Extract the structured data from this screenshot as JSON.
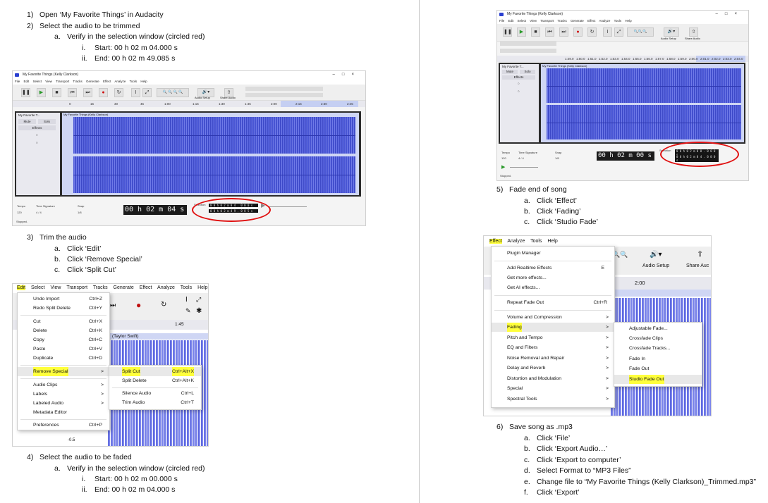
{
  "left": {
    "step1": {
      "num": "1)",
      "text": "Open ‘My Favorite Things’ in Audacity"
    },
    "step2": {
      "num": "2)",
      "text": "Select the audio to be trimmed"
    },
    "step2a": {
      "num": "a.",
      "text": "Verify in the selection window (circled red)"
    },
    "step2ai": {
      "num": "i.",
      "text": "Start: 00 h 02 m 04.000 s"
    },
    "step2aii": {
      "num": "ii.",
      "text": "End: 00 h 02 m 49.085 s"
    },
    "step3": {
      "num": "3)",
      "text": "Trim the audio"
    },
    "step3a": {
      "num": "a.",
      "text": "Click ‘Edit’"
    },
    "step3b": {
      "num": "b.",
      "text": "Click ‘Remove Special’"
    },
    "step3c": {
      "num": "c.",
      "text": "Click ‘Split Cut’"
    },
    "step4": {
      "num": "4)",
      "text": "Select the audio to be faded"
    },
    "step4a": {
      "num": "a.",
      "text": "Verify in the selection window (circled red)"
    },
    "step4ai": {
      "num": "i.",
      "text": "Start: 00 h 02 m 00.000 s"
    },
    "step4aii": {
      "num": "ii.",
      "text": "End: 00 h 02 m 04.000 s"
    }
  },
  "right": {
    "step5": {
      "num": "5)",
      "text": "Fade end of song"
    },
    "step5a": {
      "num": "a.",
      "text": "Click ‘Effect’"
    },
    "step5b": {
      "num": "b.",
      "text": "Click ‘Fading’"
    },
    "step5c": {
      "num": "c.",
      "text": "Click ‘Studio Fade’"
    },
    "step6": {
      "num": "6)",
      "text": "Save song as .mp3"
    },
    "step6a": {
      "num": "a.",
      "text": "Click ‘File’"
    },
    "step6b": {
      "num": "b.",
      "text": "Click ‘Export Audio…’"
    },
    "step6c": {
      "num": "c.",
      "text": "Click ‘Export to computer’"
    },
    "step6d": {
      "num": "d.",
      "text": "Select Format to “MP3 Files”"
    },
    "step6e": {
      "num": "e.",
      "text": "Change file to “My Favorite Things (Kelly Clarkson)_Trimmed.mp3”"
    },
    "step6f": {
      "num": "f.",
      "text": "Click ‘Export’"
    }
  },
  "shot1": {
    "title": "My Favorite Things (Kelly Clarkson)",
    "menu": "File Edit Select View Transport Tracks Generate Effect Analyze Tools Help",
    "ruler_ticks": [
      "0",
      "15",
      "30",
      "45",
      "1:00",
      "1:15",
      "1:30",
      "1:45",
      "2:00",
      "2:15",
      "2:30",
      "2:45"
    ],
    "track_name": "My Favorite T...",
    "clip_name": "My Favorite Things (Kelly Clarkson)",
    "mute": "Mute",
    "solo": "Solo",
    "effects": "Effects",
    "tempo_label": "Tempo",
    "tempo_value": "120",
    "timesig_label": "Time Signature",
    "timesig_value": "4 / 4",
    "snap_label": "Snap",
    "snap_value": "1/8",
    "audio_setup": "Audio Setup",
    "share_audio": "Share Audio",
    "time": "00 h 02 m 04 s",
    "selection_label": "Selection",
    "sel_start": "0 0 h 0 2 m 0 4 . 0 0 0 s",
    "sel_end": "0 0 h 0 2 m 4 9 . 0 8 5 s",
    "status": "Stopped."
  },
  "shot2": {
    "title": "My Favorite Things (Kelly Clarkson)",
    "menu": "File Edit Select View Transport Tracks Generate Effect Analyze Tools Help",
    "ruler_ticks": [
      "1:49.0",
      "1:50.0",
      "1:51.0",
      "1:52.0",
      "1:53.0",
      "1:54.0",
      "1:55.0",
      "1:56.0",
      "1:57.0",
      "1:58.0",
      "1:59.0",
      "2:00.0",
      "2:01.0",
      "2:02.0",
      "2:03.0",
      "2:04.0"
    ],
    "track_name": "My Favorite T...",
    "clip_name": "My Favorite Things (Kelly Clarkson)",
    "mute": "Mute",
    "solo": "Solo",
    "effects": "Effects",
    "tempo_label": "Tempo",
    "tempo_value": "120",
    "timesig_label": "Time Signature",
    "timesig_value": "4 / 4",
    "snap_label": "Snap",
    "snap_value": "1/8",
    "audio_setup": "Audio Setup",
    "share_audio": "Share Audio",
    "time": "00 h 02 m 00 s",
    "selection_label": "Selection",
    "sel_start": "0 0 h 0 2 m 0 0 . 0 0 0 s",
    "sel_end": "0 0 h 0 2 m 0 4 . 0 0 0 s",
    "status": "Stopped."
  },
  "edit_shot": {
    "menubar": [
      "Edit",
      "Select",
      "View",
      "Transport",
      "Tracks",
      "Generate",
      "Effect",
      "Analyze",
      "Tools",
      "Help"
    ],
    "items": [
      {
        "label": "Undo Import",
        "shortcut": "Ctrl+Z"
      },
      {
        "label": "Redo Split Delete",
        "shortcut": "Ctrl+Y"
      },
      {
        "label": "Cut",
        "shortcut": "Ctrl+X"
      },
      {
        "label": "Delete",
        "shortcut": "Ctrl+K"
      },
      {
        "label": "Copy",
        "shortcut": "Ctrl+C"
      },
      {
        "label": "Paste",
        "shortcut": "Ctrl+V"
      },
      {
        "label": "Duplicate",
        "shortcut": "Ctrl+D"
      },
      {
        "label": "Remove Special",
        "shortcut": ">"
      },
      {
        "label": "Audio Clips",
        "shortcut": ">"
      },
      {
        "label": "Labels",
        "shortcut": ">"
      },
      {
        "label": "Labeled Audio",
        "shortcut": ">"
      },
      {
        "label": "Metadata Editor",
        "shortcut": ""
      },
      {
        "label": "Preferences",
        "shortcut": "Ctrl+P"
      }
    ],
    "submenu": [
      {
        "label": "Split Cut",
        "shortcut": "Ctrl+Alt+X"
      },
      {
        "label": "Split Delete",
        "shortcut": "Ctrl+Alt+K"
      },
      {
        "label": "Silence Audio",
        "shortcut": "Ctrl+L"
      },
      {
        "label": "Trim Audio",
        "shortcut": "Ctrl+T"
      }
    ],
    "ruler_tick": "1:45",
    "clip_label": "(Taylor Swift)",
    "scale_label": "-0.5"
  },
  "effect_shot": {
    "menubar": [
      "Effect",
      "Analyze",
      "Tools",
      "Help"
    ],
    "items": [
      {
        "label": "Plugin Manager",
        "shortcut": ""
      },
      {
        "label": "Add Realtime Effects",
        "shortcut": "E"
      },
      {
        "label": "Get more effects...",
        "shortcut": ""
      },
      {
        "label": "Get AI effects...",
        "shortcut": ""
      },
      {
        "label": "Repeat Fade Out",
        "shortcut": "Ctrl+R"
      },
      {
        "label": "Volume and Compression",
        "shortcut": ">"
      },
      {
        "label": "Fading",
        "shortcut": ">"
      },
      {
        "label": "Pitch and Tempo",
        "shortcut": ">"
      },
      {
        "label": "EQ and Filters",
        "shortcut": ">"
      },
      {
        "label": "Noise Removal and Repair",
        "shortcut": ">"
      },
      {
        "label": "Delay and Reverb",
        "shortcut": ">"
      },
      {
        "label": "Distortion and Modulation",
        "shortcut": ">"
      },
      {
        "label": "Special",
        "shortcut": ">"
      },
      {
        "label": "Spectral Tools",
        "shortcut": ">"
      }
    ],
    "submenu": [
      "Adjustable Fade...",
      "Crossfade Clips",
      "Crossfade Tracks...",
      "Fade In",
      "Fade Out",
      "Studio Fade Out"
    ],
    "audio_setup": "Audio Setup",
    "share_audio": "Share Auc",
    "ruler_tick": "2:00"
  },
  "colors": {
    "highlight": "#ffff3c",
    "red_circle": "#e01010",
    "waveform": "#4a57d6"
  }
}
